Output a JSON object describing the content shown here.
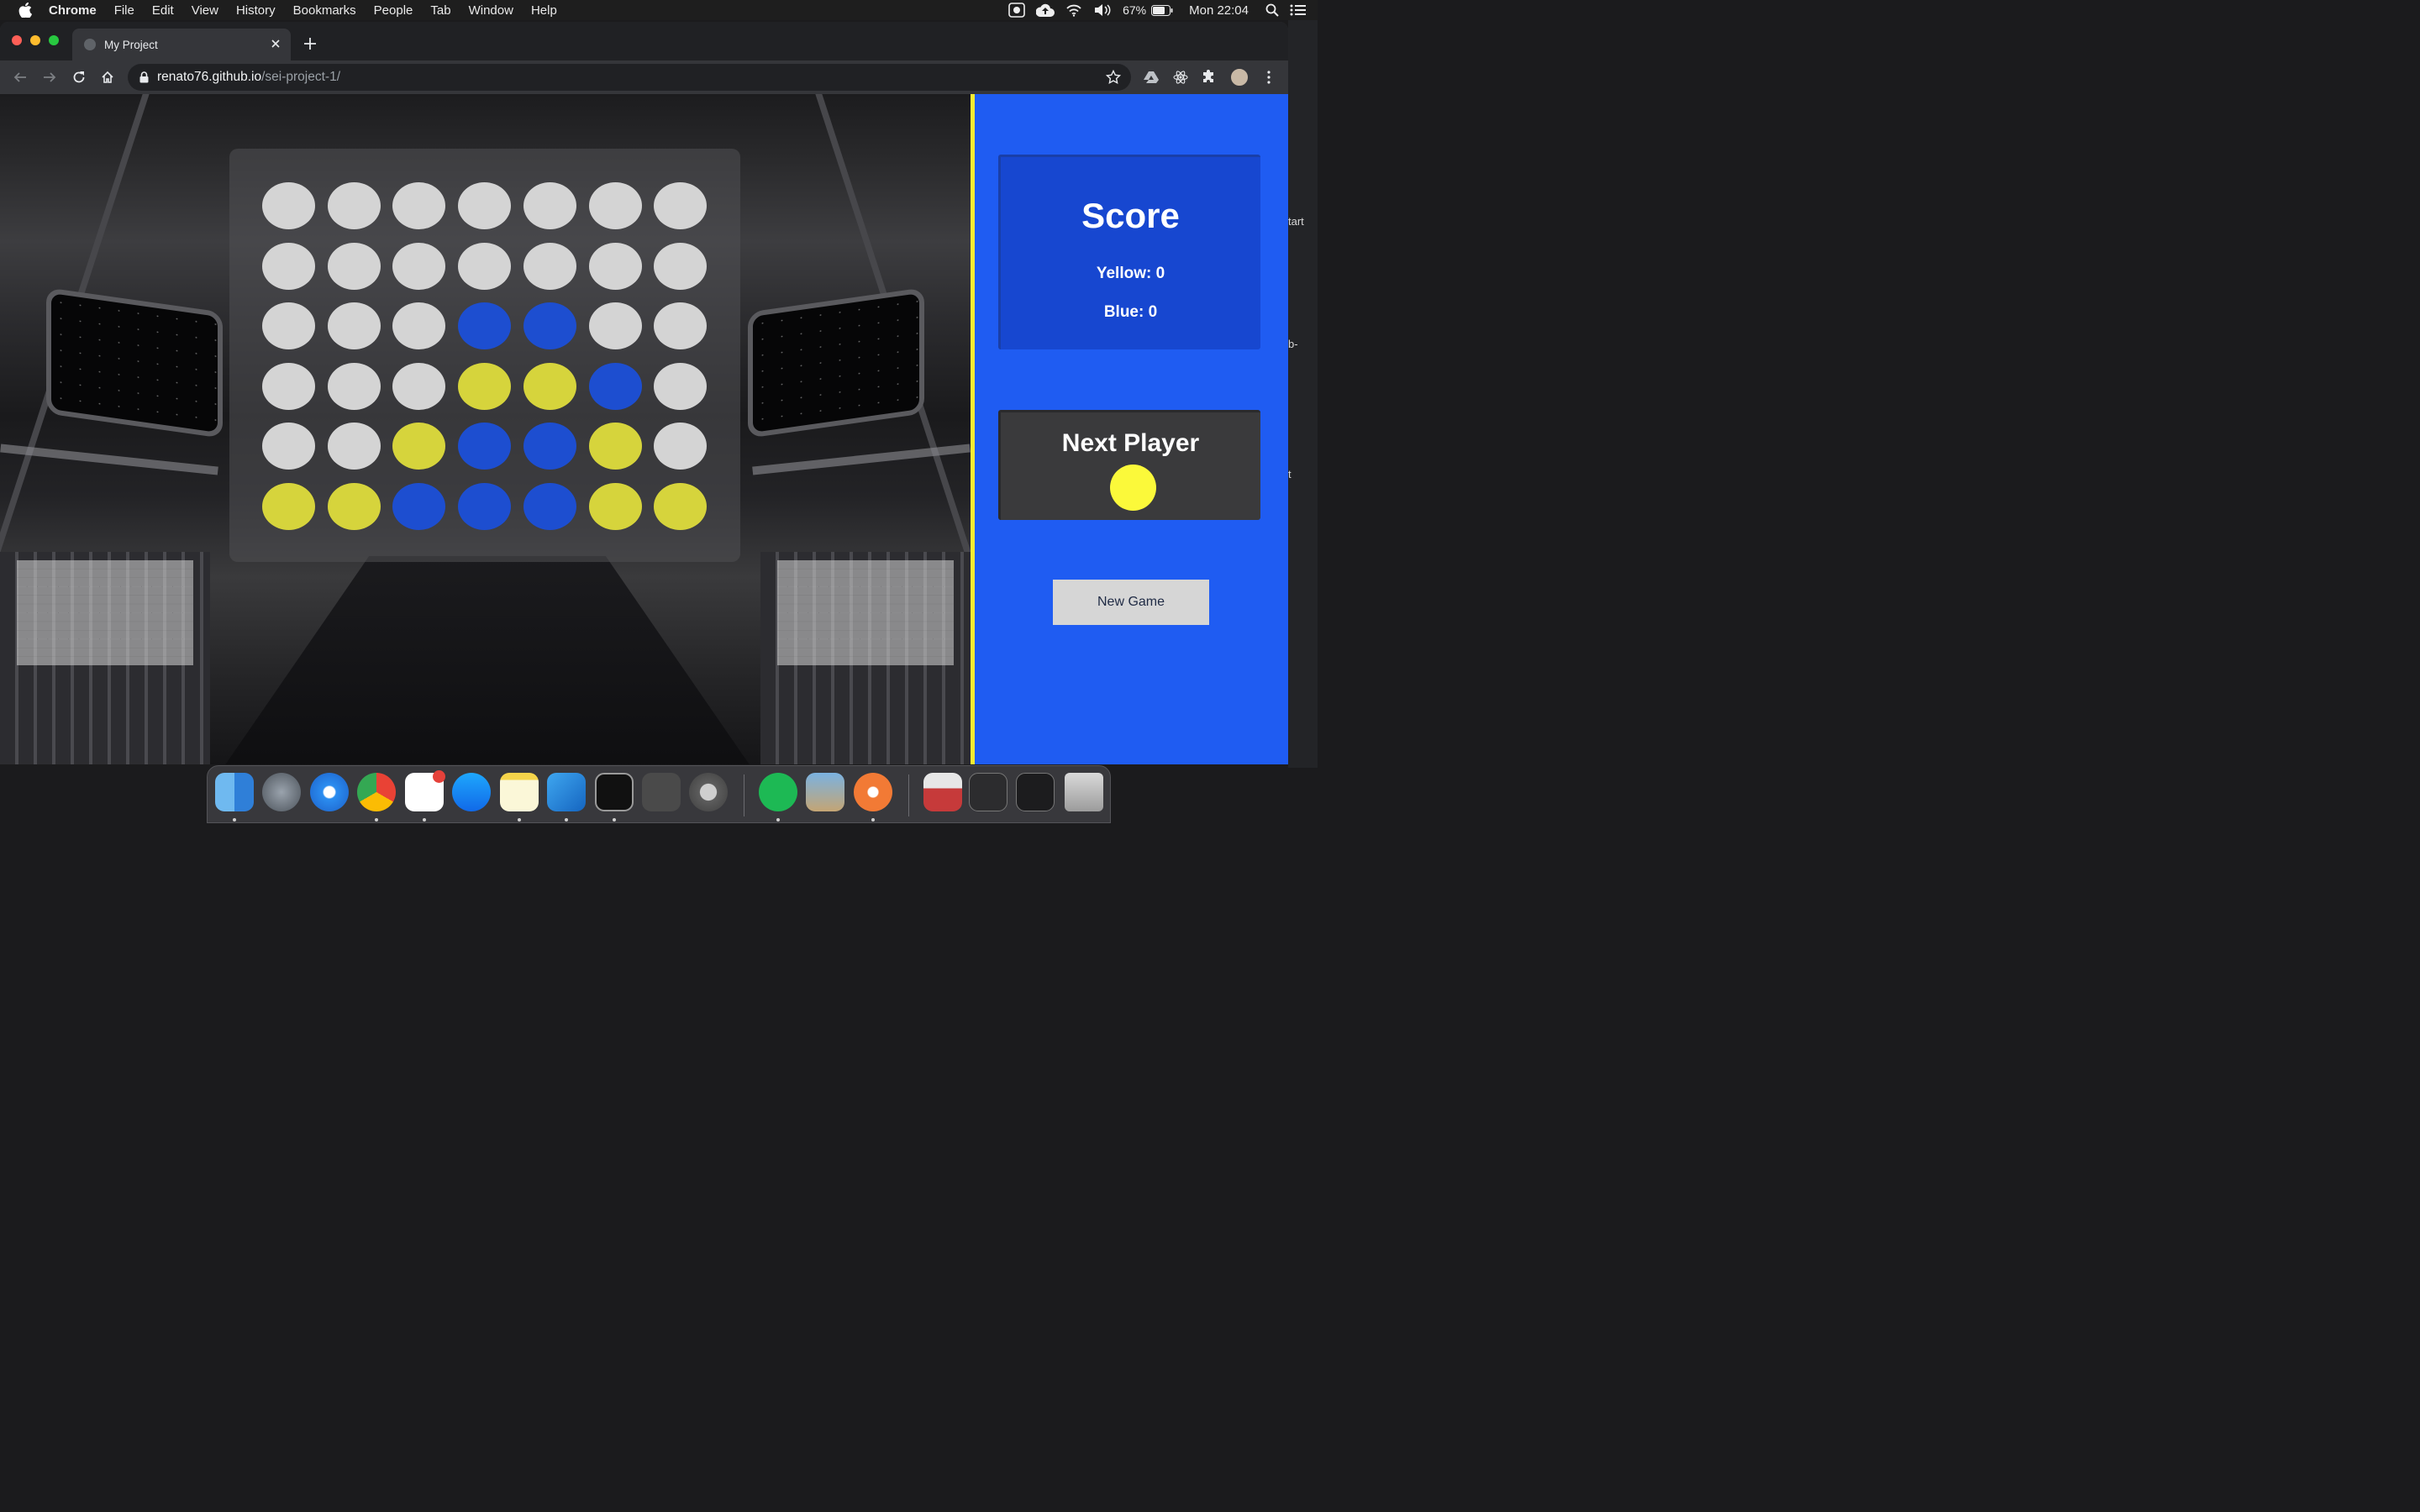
{
  "menubar": {
    "app_name": "Chrome",
    "menus": [
      "File",
      "Edit",
      "View",
      "History",
      "Bookmarks",
      "People",
      "Tab",
      "Window",
      "Help"
    ],
    "battery": "67%",
    "clock": "Mon 22:04"
  },
  "browser": {
    "tab_title": "My Project",
    "url_host": "renato76.github.io",
    "url_path": "/sei-project-1/"
  },
  "desktop_fragments": [
    "tart",
    "b-",
    "t"
  ],
  "game": {
    "board": [
      [
        "empty",
        "empty",
        "empty",
        "empty",
        "empty",
        "empty",
        "empty"
      ],
      [
        "empty",
        "empty",
        "empty",
        "empty",
        "empty",
        "empty",
        "empty"
      ],
      [
        "empty",
        "empty",
        "empty",
        "blue",
        "blue",
        "empty",
        "empty"
      ],
      [
        "empty",
        "empty",
        "empty",
        "yellow",
        "yellow",
        "blue",
        "empty"
      ],
      [
        "empty",
        "empty",
        "yellow",
        "blue",
        "blue",
        "yellow",
        "empty"
      ],
      [
        "yellow",
        "yellow",
        "blue",
        "blue",
        "blue",
        "yellow",
        "yellow"
      ]
    ],
    "colors": {
      "yellow": "#d6d43c",
      "blue": "#1d4ed0",
      "empty": "#d4d4d4",
      "panel": "#1f5cf2",
      "divider": "#f5ec33"
    },
    "score": {
      "title": "Score",
      "yellow_text": "Yellow: 0",
      "blue_text": "Blue: 0"
    },
    "next_player": {
      "title": "Next Player",
      "color": "#fbf93a"
    },
    "new_game_label": "New Game"
  },
  "dock": {
    "apps": [
      "Finder",
      "Launchpad",
      "Safari",
      "Google Chrome",
      "Slack",
      "App Store",
      "Notes",
      "Visual Studio Code",
      "Terminal",
      "Sublime Text",
      "System Preferences",
      "Spotify",
      "Preview",
      "Screenshot",
      "Downloads",
      "Stack 1",
      "Stack 2",
      "Trash"
    ]
  }
}
